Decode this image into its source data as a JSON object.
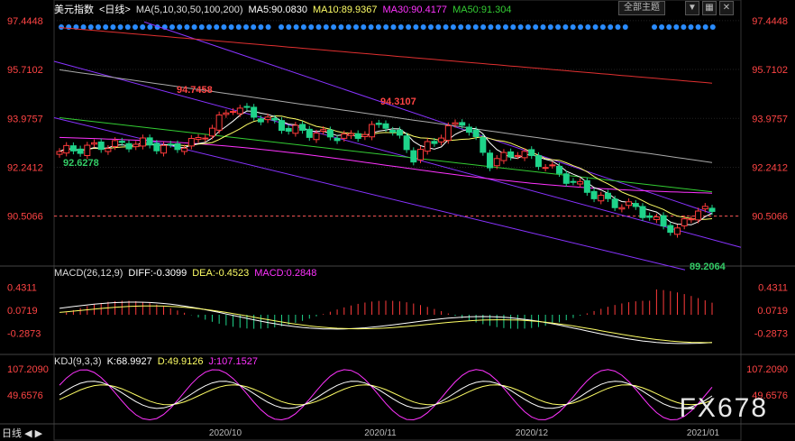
{
  "header": {
    "symbol": "美元指数",
    "period": "<日线>",
    "ma_label": "MA(5,10,30,50,100,200)",
    "ma5": "MA5:90.0830",
    "ma10": "MA10:89.9367",
    "ma30": "MA30:90.4177",
    "ma50": "MA50:91.304",
    "theme_button": "全部主题",
    "icons": [
      "down-arrow-icon",
      "chart-settings-icon",
      "close-icon"
    ]
  },
  "macd_header": {
    "label": "MACD(26,12,9)",
    "diff": "DIFF:-0.3099",
    "dea": "DEA:-0.4523",
    "macd": "MACD:0.2848"
  },
  "kdj_header": {
    "label": "KDJ(9,3,3)",
    "k": "K:68.9927",
    "d": "D:49.9126",
    "j": "J:107.1527"
  },
  "bottom_tab": "日线",
  "watermark": "FX678",
  "colors": {
    "up": "#ff3b3b",
    "down": "#1fd38a",
    "ma5": "#ffffff",
    "ma10": "#ffff66",
    "ma30": "#ff33ff",
    "ma50": "#33cc33",
    "ma100": "#aaaaaa",
    "ma200": "#e03030",
    "channel": "#8833ff",
    "price_line": "#ff5555",
    "dots": "#2a8cff"
  },
  "chart_data": {
    "type": "candlestick",
    "price_axis_ticks": [
      "97.4448",
      "95.7102",
      "93.9757",
      "92.2412",
      "90.5066"
    ],
    "current_price_level": 90.5066,
    "x_ticks": [
      "2020/10",
      "2020/11",
      "2020/12",
      "2021/01"
    ],
    "annotations": [
      {
        "text": "94.7458",
        "type": "high"
      },
      {
        "text": "92.6278",
        "type": "low"
      },
      {
        "text": "94.3107",
        "type": "high"
      },
      {
        "text": "89.2064",
        "type": "low"
      }
    ],
    "macd_axis_ticks": [
      "0.4311",
      "0.0719",
      "-0.2873"
    ],
    "kdj_axis_ticks": [
      "107.2090",
      "49.6576"
    ],
    "ylim": [
      88.8,
      97.6
    ]
  }
}
